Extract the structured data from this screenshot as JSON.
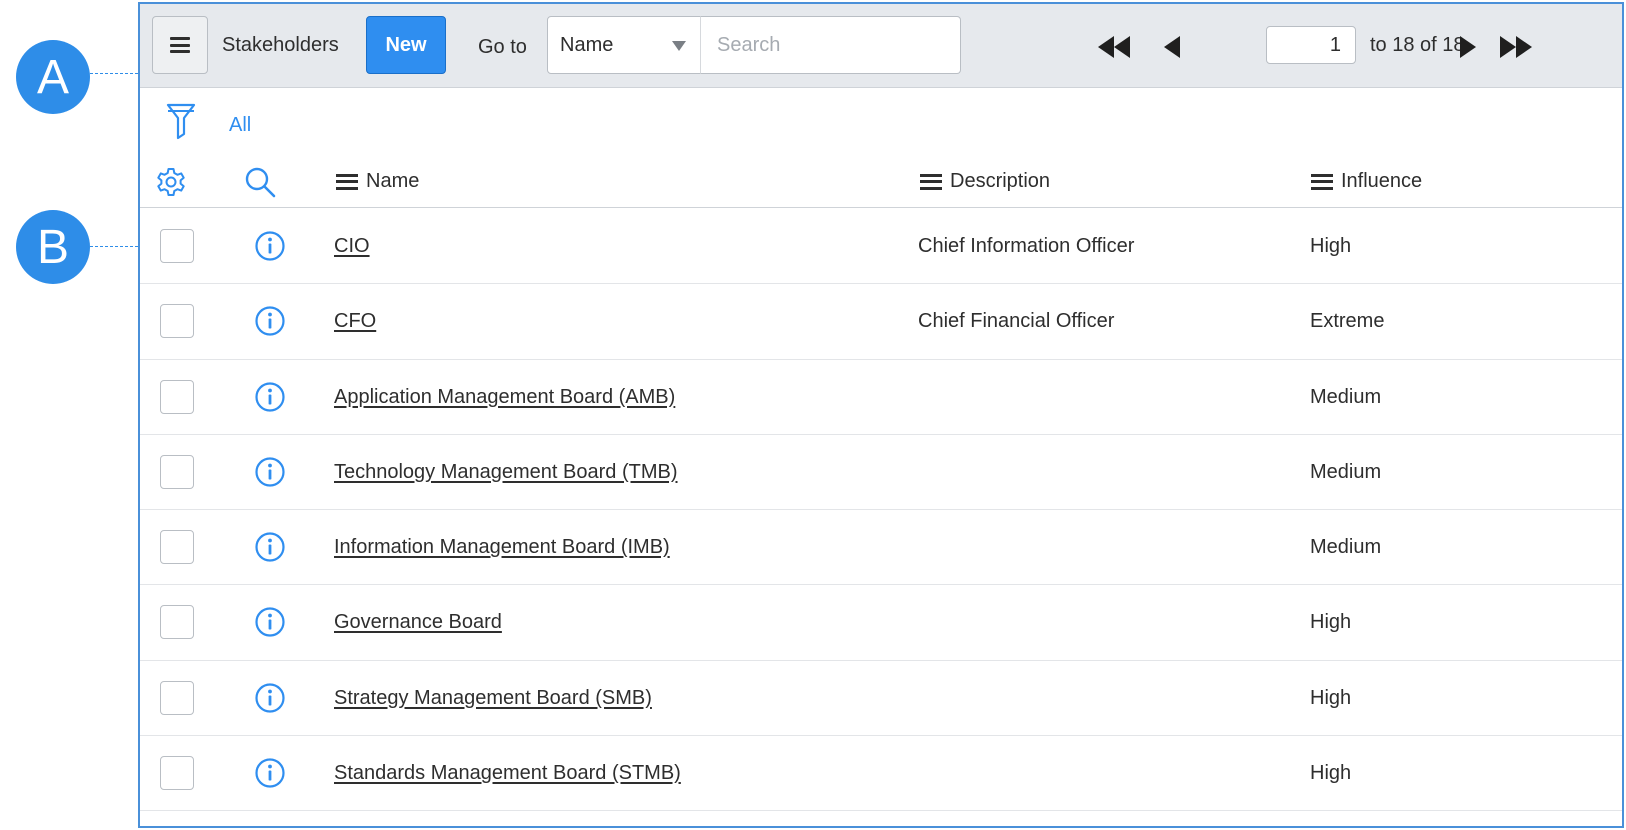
{
  "callouts": [
    {
      "label": "A"
    },
    {
      "label": "B"
    }
  ],
  "header": {
    "title": "Stakeholders",
    "new_label": "New",
    "goto_label": "Go to",
    "select_value": "Name",
    "search_placeholder": "Search",
    "page_value": "1",
    "range_text": "to 18 of 18"
  },
  "filter": {
    "all_label": "All"
  },
  "columns": {
    "name": "Name",
    "description": "Description",
    "influence": "Influence"
  },
  "rows": [
    {
      "name": "CIO",
      "description": "Chief Information Officer",
      "influence": "High"
    },
    {
      "name": "CFO",
      "description": "Chief Financial Officer",
      "influence": "Extreme"
    },
    {
      "name": "Application Management Board (AMB)",
      "description": "",
      "influence": "Medium"
    },
    {
      "name": "Technology Management Board (TMB)",
      "description": "",
      "influence": "Medium"
    },
    {
      "name": "Information Management Board (IMB)",
      "description": "",
      "influence": "Medium"
    },
    {
      "name": "Governance Board",
      "description": "",
      "influence": "High"
    },
    {
      "name": "Strategy Management Board (SMB)",
      "description": "",
      "influence": "High"
    },
    {
      "name": "Standards Management Board (STMB)",
      "description": "",
      "influence": "High"
    }
  ],
  "colors": {
    "accent": "#2f8ef0",
    "callout": "#2e8de8",
    "header_bg": "#e6e9ed"
  },
  "icons": [
    "hamburger-icon",
    "first-page-icon",
    "prev-page-icon",
    "next-page-icon",
    "last-page-icon",
    "filter-icon",
    "gear-icon",
    "search-icon",
    "info-icon",
    "column-menu-icon"
  ]
}
